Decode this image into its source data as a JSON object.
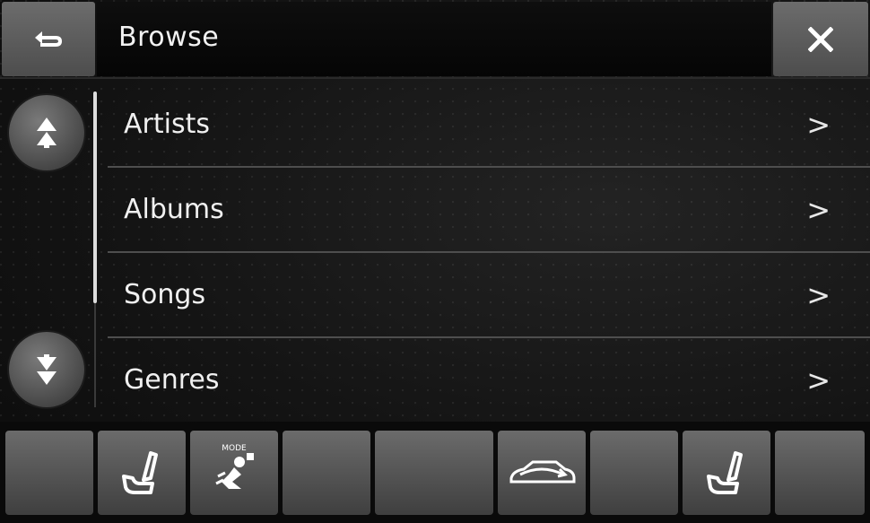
{
  "header": {
    "title": "Browse",
    "back_icon": "back-arrow-icon",
    "close_icon": "close-icon"
  },
  "scroll": {
    "up_icon": "page-up-icon",
    "down_icon": "page-down-icon"
  },
  "list": {
    "items": [
      {
        "label": "Artists",
        "chevron": ">"
      },
      {
        "label": "Albums",
        "chevron": ">"
      },
      {
        "label": "Songs",
        "chevron": ">"
      },
      {
        "label": "Genres",
        "chevron": ">"
      }
    ]
  },
  "climate_bar": {
    "mode_label": "MODE",
    "buttons": [
      {
        "icon": "blank"
      },
      {
        "icon": "seat-heater-icon"
      },
      {
        "icon": "climate-mode-icon"
      },
      {
        "icon": "blank"
      },
      {
        "icon": "blank"
      },
      {
        "icon": "recirculation-icon"
      },
      {
        "icon": "blank"
      },
      {
        "icon": "seat-heater-icon"
      },
      {
        "icon": "blank"
      }
    ]
  },
  "colors": {
    "button": "#5a5a5a",
    "text": "#f0f0f0",
    "divider": "#4e4e4e"
  }
}
